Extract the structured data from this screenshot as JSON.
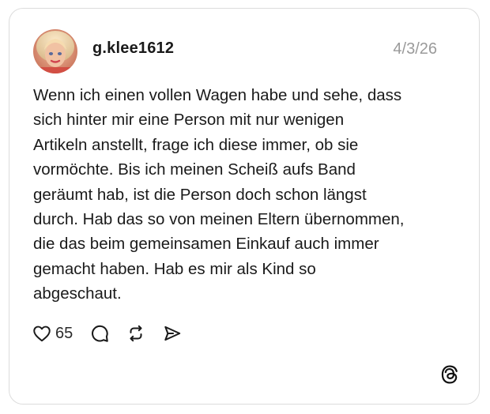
{
  "post": {
    "username": "g.klee1612",
    "timestamp": "4/3/26",
    "text_lines": [
      "Wenn ich einen vollen Wagen habe und sehe, dass",
      "sich hinter mir eine Person mit nur wenigen",
      "Artikeln anstellt, frage ich diese immer, ob sie",
      "vormöchte. Bis ich meinen Scheiß aufs Band",
      "geräumt hab, ist die Person doch schon längst",
      "durch. Hab das so von meinen Eltern übernommen,",
      "die das beim gemeinsamen Einkauf auch immer",
      "gemacht haben. Hab es mir als Kind so",
      "abgeschaut."
    ]
  },
  "actions": {
    "like_count": "65",
    "icons": [
      "heart-icon",
      "comment-icon",
      "repost-icon",
      "share-icon"
    ]
  },
  "brand": {
    "logo": "threads-logo-icon"
  },
  "colors": {
    "text": "#1a1a1a",
    "timestamp": "#9a9a9a",
    "border": "#dcdcdc",
    "background": "#ffffff"
  }
}
